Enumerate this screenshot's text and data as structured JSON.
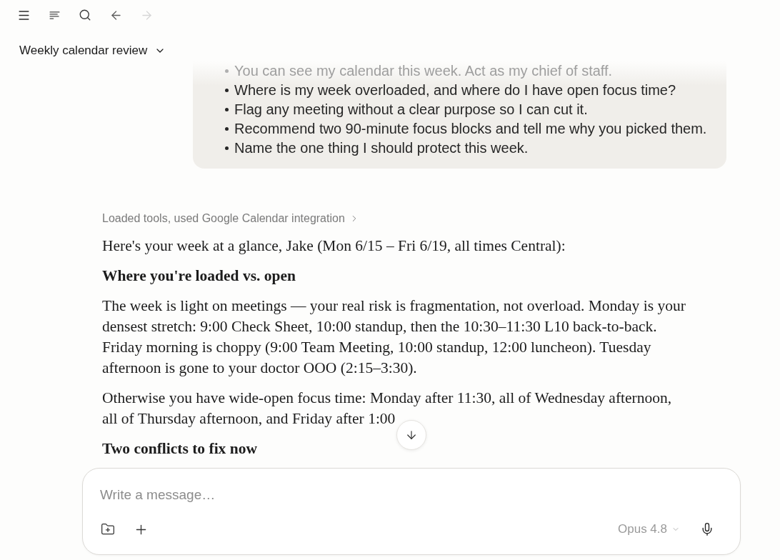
{
  "toolbar": [
    {
      "kind": "menu",
      "disabled": false
    },
    {
      "kind": "outline",
      "disabled": false
    },
    {
      "kind": "search",
      "disabled": false
    },
    {
      "kind": "back",
      "disabled": false
    },
    {
      "kind": "forward",
      "disabled": true
    }
  ],
  "conversation": {
    "title": "Weekly calendar review"
  },
  "user_message": {
    "items": [
      {
        "text": "You can see my calendar this week. Act as my chief of staff.",
        "faded": true
      },
      {
        "text": "Where is my week overloaded, and where do I have open focus time?",
        "faded": false
      },
      {
        "text": "Flag any meeting without a clear purpose so I can cut it.",
        "faded": false
      },
      {
        "text": "Recommend two 90-minute focus blocks and tell me why you picked them.",
        "faded": false
      },
      {
        "text": "Name the one thing I should protect this week.",
        "faded": false
      }
    ]
  },
  "assistant_message": {
    "tool_summary": "Loaded tools, used Google Calendar integration",
    "blocks": [
      {
        "kind": "paragraph",
        "text": "Here's your week at a glance, Jake (Mon 6/15 – Fri 6/19, all times Central):"
      },
      {
        "kind": "heading",
        "text": "Where you're loaded vs. open"
      },
      {
        "kind": "paragraph",
        "text": "The week is light on meetings — your real risk is fragmentation, not overload. Monday is your densest stretch: 9:00 Check Sheet, 10:00 standup, then the 10:30–11:30 L10 back-to-back. Friday morning is choppy (9:00 Team Meeting, 10:00 standup, 12:00 luncheon). Tuesday afternoon is gone to your doctor OOO (2:15–3:30)."
      },
      {
        "kind": "paragraph",
        "text": "Otherwise you have wide-open focus time: Monday after 11:30, all of Wednesday afternoon, all of Thursday afternoon, and Friday after 1:00"
      },
      {
        "kind": "heading",
        "text": "Two conflicts to fix now"
      }
    ]
  },
  "composer": {
    "placeholder": "Write a message…",
    "model": "Opus 4.8"
  }
}
